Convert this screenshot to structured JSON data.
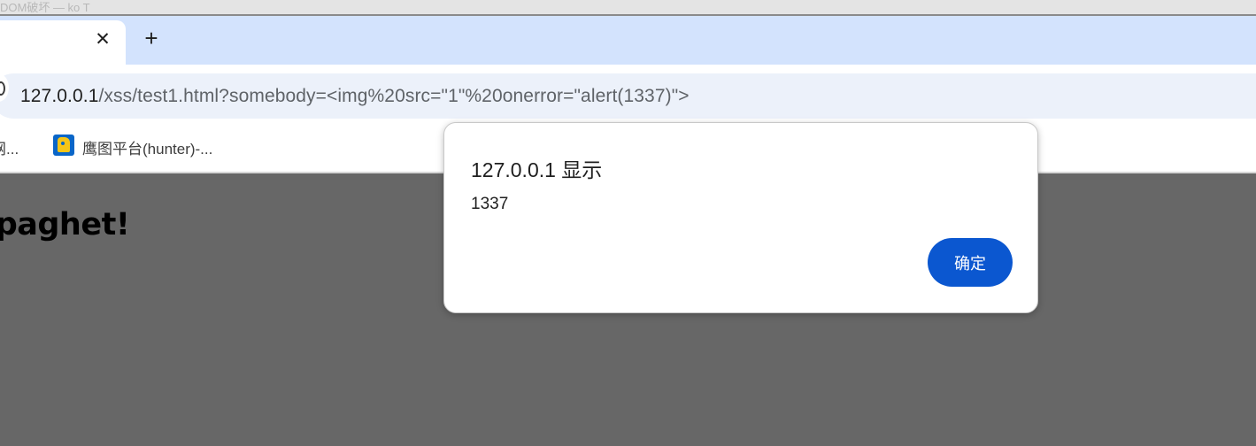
{
  "window": {
    "title_fragment": "DOM破坏 — ko T"
  },
  "tabs": {
    "close_glyph": "✕",
    "new_tab_glyph": "+"
  },
  "address_bar": {
    "host": "127.0.0.1",
    "path": "/xss/test1.html?somebody=<img%20src=\"1\"%20onerror=\"alert(1337)\">"
  },
  "bookmarks": [
    {
      "label": "网..."
    },
    {
      "label": "鹰图平台(hunter)-...",
      "icon": "hunter-favicon-icon"
    }
  ],
  "page": {
    "heading": "Spaghet!"
  },
  "alert_dialog": {
    "title": "127.0.0.1 显示",
    "message": "1337",
    "ok_label": "确定"
  },
  "colors": {
    "tabstrip": "#d3e3fd",
    "omnibox": "#ecf1fa",
    "page_overlay": "#676767",
    "ok_button": "#0b57d0"
  }
}
